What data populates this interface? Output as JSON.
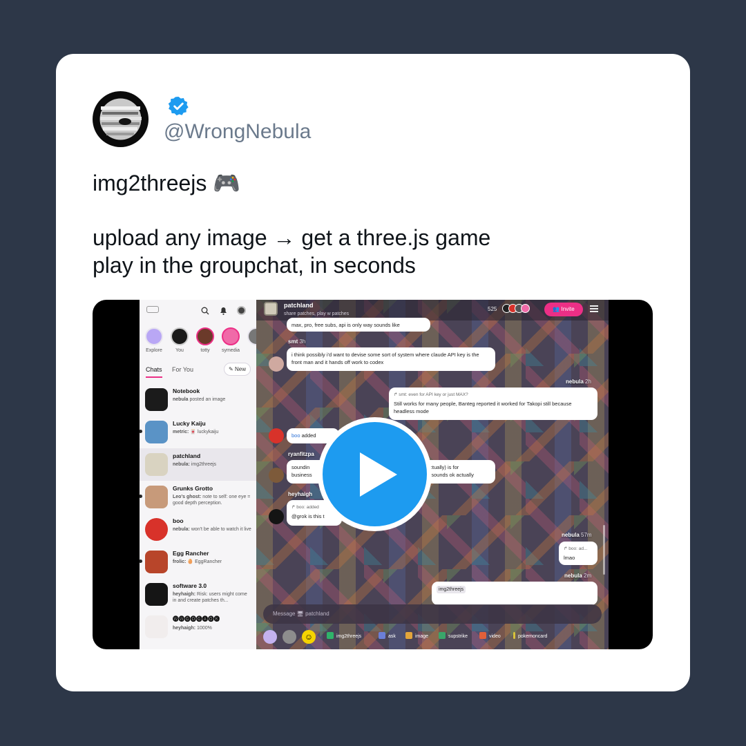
{
  "tweet": {
    "handle": "@WrongNebula",
    "line1": "img2threejs 🎮",
    "line2": "upload any image → get a three.js game",
    "line3": "play in the groupchat, in seconds"
  },
  "colors": {
    "verified": "#1d9bf0",
    "accent": "#ec2f86",
    "play": "#1d9bf0"
  },
  "sidebar": {
    "stories": [
      {
        "label": "Explore"
      },
      {
        "label": "You"
      },
      {
        "label": "totty"
      },
      {
        "label": "symedia"
      }
    ],
    "tabs": {
      "chats": "Chats",
      "for_you": "For You",
      "new": "New"
    },
    "chats": [
      {
        "name": "Notebook",
        "preview_user": "nebula",
        "preview": "posted an image"
      },
      {
        "name": "Lucky Kaiju",
        "preview_user": "metric:",
        "preview": "🀄 luckykaiju"
      },
      {
        "name": "patchland",
        "preview_user": "nebula:",
        "preview": "img2threejs"
      },
      {
        "name": "Grunks Grotto",
        "preview_user": "Leo's ghost:",
        "preview": "note to self: one eye = good depth perception."
      },
      {
        "name": "boo",
        "preview_user": "nebula:",
        "preview": "won't be able to watch it live"
      },
      {
        "name": "Egg Rancher",
        "preview_user": "frolic:",
        "preview": "🥚 EggRancher"
      },
      {
        "name": "software 3.0",
        "preview_user": "heyhaigh:",
        "preview": "Risk: users might come in and create patches th..."
      },
      {
        "name": "🅦🅦🅖🅞🅖🅐🅞🅚",
        "preview_user": "heyhaigh:",
        "preview": "1000%"
      }
    ]
  },
  "chat": {
    "title": "patchland",
    "subtitle": "share patches, play w patches",
    "member_count": "525",
    "invite": "Invite",
    "messages": [
      {
        "text": "max, pro, free subs, api is only way sounds like"
      },
      {
        "name": "smt",
        "time": "3h",
        "text": "i think possibly i'd want to devise some sort of system where claude API key is the front man and it hands off work to codex"
      },
      {
        "name": "nebula",
        "time": "2h",
        "reply": "smt: even for API key or just MAX?",
        "text": "Still works for many people, Banteg reported it worked for Takopi still because headless mode"
      },
      {
        "name": "boo",
        "text": "added"
      },
      {
        "name": "ryanfitzpa",
        "text_left": "soundin",
        "text_left2": "business",
        "text_right": "actually) is for",
        "text_right2": "n sounds ok actually"
      },
      {
        "name": "heyhaigh",
        "reply": "boo: added",
        "text": "@grok is this t"
      },
      {
        "name": "nebula",
        "time": "57m",
        "reply": "boo: ad...",
        "text": "lmao"
      },
      {
        "name": "nebula",
        "time": "2m",
        "text": "img2threejs"
      }
    ],
    "composer_placeholder": "Message 🖥 patchland",
    "tools": [
      "img2threejs",
      "ask",
      "image",
      "supstrike",
      "video",
      "pokemoncard"
    ]
  }
}
